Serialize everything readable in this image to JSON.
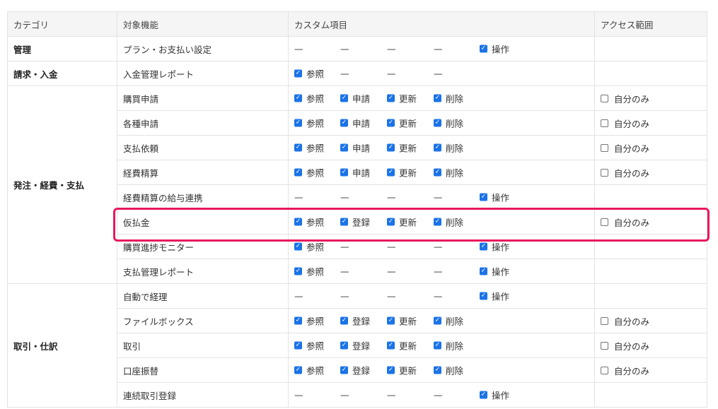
{
  "header": {
    "category": "カテゴリ",
    "feature": "対象機能",
    "custom": "カスタム項目",
    "access": "アクセス範囲"
  },
  "groups": [
    {
      "category": "管理",
      "rows": [
        {
          "feature": "プラン・お支払い設定",
          "items": [
            {
              "t": "dash"
            },
            {
              "t": "dash"
            },
            {
              "t": "dash"
            },
            {
              "t": "dash"
            },
            {
              "t": "check",
              "label": "操作"
            }
          ],
          "access": null
        }
      ]
    },
    {
      "category": "請求・入金",
      "rows": [
        {
          "feature": "入金管理レポート",
          "items": [
            {
              "t": "check",
              "label": "参照"
            },
            {
              "t": "dash"
            },
            {
              "t": "dash"
            },
            {
              "t": "dash"
            }
          ],
          "access": null
        }
      ]
    },
    {
      "category": "発注・経費・支払",
      "rows": [
        {
          "feature": "購買申請",
          "items": [
            {
              "t": "check",
              "label": "参照"
            },
            {
              "t": "check",
              "label": "申請"
            },
            {
              "t": "check",
              "label": "更新"
            },
            {
              "t": "check",
              "label": "削除"
            }
          ],
          "access": "自分のみ"
        },
        {
          "feature": "各種申請",
          "items": [
            {
              "t": "check",
              "label": "参照"
            },
            {
              "t": "check",
              "label": "申請"
            },
            {
              "t": "check",
              "label": "更新"
            },
            {
              "t": "check",
              "label": "削除"
            }
          ],
          "access": "自分のみ"
        },
        {
          "feature": "支払依頼",
          "items": [
            {
              "t": "check",
              "label": "参照"
            },
            {
              "t": "check",
              "label": "申請"
            },
            {
              "t": "check",
              "label": "更新"
            },
            {
              "t": "check",
              "label": "削除"
            }
          ],
          "access": "自分のみ"
        },
        {
          "feature": "経費精算",
          "items": [
            {
              "t": "check",
              "label": "参照"
            },
            {
              "t": "check",
              "label": "申請"
            },
            {
              "t": "check",
              "label": "更新"
            },
            {
              "t": "check",
              "label": "削除"
            }
          ],
          "access": "自分のみ"
        },
        {
          "feature": "経費精算の給与連携",
          "items": [
            {
              "t": "dash"
            },
            {
              "t": "dash"
            },
            {
              "t": "dash"
            },
            {
              "t": "dash"
            },
            {
              "t": "check",
              "label": "操作"
            }
          ],
          "access": null
        },
        {
          "feature": "仮払金",
          "items": [
            {
              "t": "check",
              "label": "参照"
            },
            {
              "t": "check",
              "label": "登録"
            },
            {
              "t": "check",
              "label": "更新"
            },
            {
              "t": "check",
              "label": "削除"
            }
          ],
          "access": "自分のみ"
        },
        {
          "feature": "購買進捗モニター",
          "items": [
            {
              "t": "check",
              "label": "参照"
            },
            {
              "t": "dash"
            },
            {
              "t": "dash"
            },
            {
              "t": "dash"
            },
            {
              "t": "check",
              "label": "操作"
            }
          ],
          "access": null
        },
        {
          "feature": "支払管理レポート",
          "items": [
            {
              "t": "check",
              "label": "参照"
            },
            {
              "t": "dash"
            },
            {
              "t": "dash"
            },
            {
              "t": "dash"
            },
            {
              "t": "check",
              "label": "操作"
            }
          ],
          "access": null
        }
      ]
    },
    {
      "category": "取引・仕訳",
      "rows": [
        {
          "feature": "自動で経理",
          "items": [
            {
              "t": "dash"
            },
            {
              "t": "dash"
            },
            {
              "t": "dash"
            },
            {
              "t": "dash"
            },
            {
              "t": "check",
              "label": "操作"
            }
          ],
          "access": null
        },
        {
          "feature": "ファイルボックス",
          "items": [
            {
              "t": "check",
              "label": "参照"
            },
            {
              "t": "check",
              "label": "登録"
            },
            {
              "t": "check",
              "label": "更新"
            },
            {
              "t": "check",
              "label": "削除"
            }
          ],
          "access": "自分のみ"
        },
        {
          "feature": "取引",
          "items": [
            {
              "t": "check",
              "label": "参照"
            },
            {
              "t": "check",
              "label": "登録"
            },
            {
              "t": "check",
              "label": "更新"
            },
            {
              "t": "check",
              "label": "削除"
            }
          ],
          "access": "自分のみ"
        },
        {
          "feature": "口座振替",
          "items": [
            {
              "t": "check",
              "label": "参照"
            },
            {
              "t": "check",
              "label": "登録"
            },
            {
              "t": "check",
              "label": "更新"
            },
            {
              "t": "check",
              "label": "削除"
            }
          ],
          "access": "自分のみ"
        },
        {
          "feature": "連続取引登録",
          "items": [
            {
              "t": "dash"
            },
            {
              "t": "dash"
            },
            {
              "t": "dash"
            },
            {
              "t": "dash"
            },
            {
              "t": "check",
              "label": "操作"
            }
          ],
          "access": null
        }
      ]
    }
  ],
  "symbols": {
    "dash": "—",
    "check": "✓"
  },
  "colors": {
    "checkbox": "#1a73e8",
    "highlight": "#e8185e"
  }
}
